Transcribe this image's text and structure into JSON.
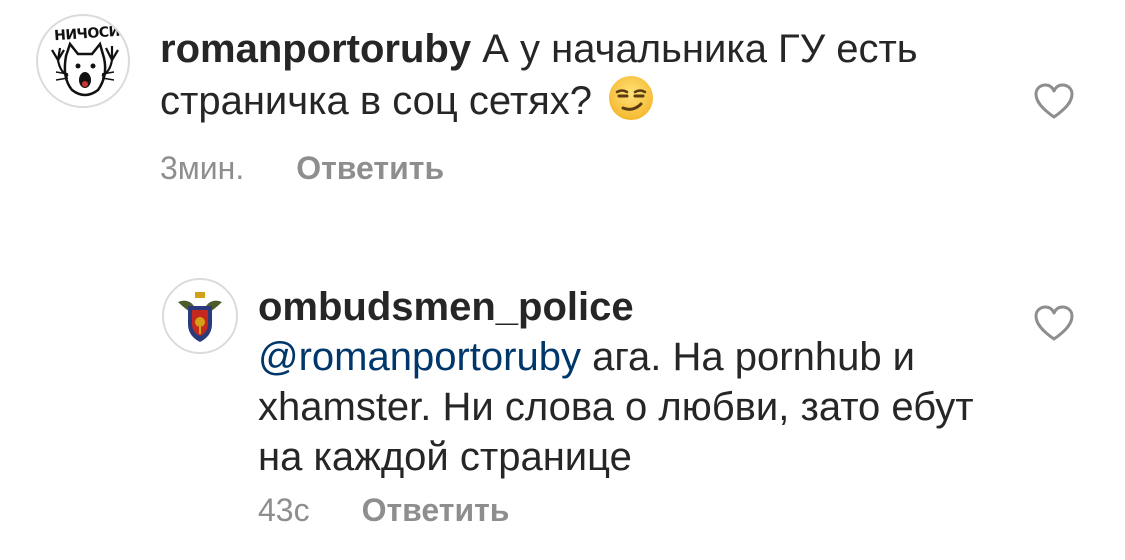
{
  "comments": [
    {
      "avatar_text": "НИЧОСИ",
      "username": "romanportoruby",
      "text": "А у начальника ГУ есть страничка в соц сетях?",
      "emoji": "smirk-emoji",
      "time": "3мин.",
      "reply_label": "Ответить",
      "like_icon": "heart-outline-icon"
    },
    {
      "username": "ombudsmen_police",
      "mention": "@romanportoruby",
      "text": "ага. На pornhub и xhamster. Ни слова о любви, зато ебут на каждой странице",
      "time": "43с",
      "reply_label": "Ответить",
      "like_icon": "heart-outline-icon"
    }
  ],
  "colors": {
    "text": "#262626",
    "meta": "#8e8e8e",
    "mention": "#00376b"
  }
}
